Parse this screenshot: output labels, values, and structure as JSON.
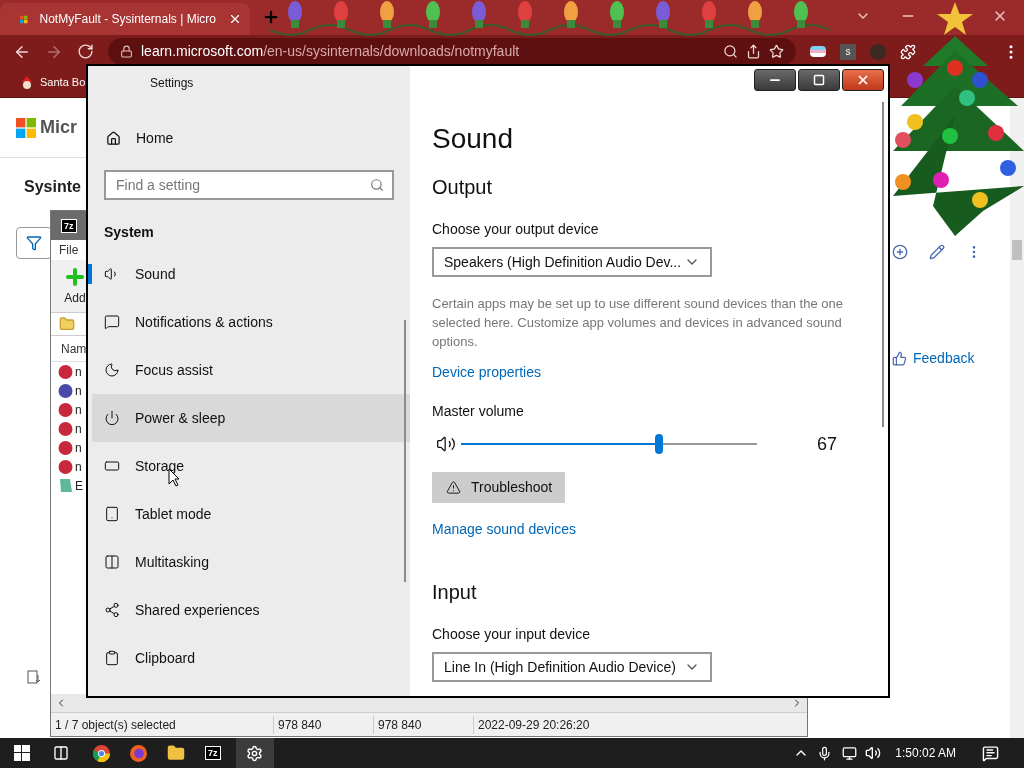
{
  "browser": {
    "tab_title": "NotMyFault - Sysinternals | Micro",
    "url_host": "learn.microsoft.com",
    "url_path": "/en-us/sysinternals/downloads/notmyfault",
    "bookmark": "Santa Bo",
    "extension_badge": "s"
  },
  "web_page": {
    "logo_text": "Micr",
    "heading": "Sysinte",
    "feedback": "Feedback"
  },
  "archiver": {
    "badge": "7z",
    "menu": "File",
    "toolbar_button": "Add",
    "column": "Nam",
    "rows": [
      {
        "name": "n",
        "kind": "archive",
        "color": "#c8283c"
      },
      {
        "name": "n",
        "kind": "archive",
        "color": "#4a4aa8"
      },
      {
        "name": "n",
        "kind": "archive",
        "color": "#c8283c"
      },
      {
        "name": "n",
        "kind": "archive",
        "color": "#c8283c"
      },
      {
        "name": "n",
        "kind": "archive",
        "color": "#c8283c"
      },
      {
        "name": "n",
        "kind": "archive",
        "color": "#c8283c"
      },
      {
        "name": "E",
        "kind": "document",
        "color": "#5fb89a"
      }
    ],
    "status": [
      "1 / 7 object(s) selected",
      "978 840",
      "978 840",
      "2022-09-29 20:26:20"
    ]
  },
  "settings": {
    "title": "Settings",
    "home": "Home",
    "search_placeholder": "Find a setting",
    "section": "System",
    "nav": [
      {
        "label": "Sound",
        "kind": "sound",
        "selected": true,
        "hovered": false
      },
      {
        "label": "Notifications & actions",
        "kind": "notifications",
        "selected": false,
        "hovered": false
      },
      {
        "label": "Focus assist",
        "kind": "focus",
        "selected": false,
        "hovered": false
      },
      {
        "label": "Power & sleep",
        "kind": "power",
        "selected": false,
        "hovered": true
      },
      {
        "label": "Storage",
        "kind": "storage",
        "selected": false,
        "hovered": false
      },
      {
        "label": "Tablet mode",
        "kind": "tablet",
        "selected": false,
        "hovered": false
      },
      {
        "label": "Multitasking",
        "kind": "multitasking",
        "selected": false,
        "hovered": false
      },
      {
        "label": "Shared experiences",
        "kind": "shared",
        "selected": false,
        "hovered": false
      },
      {
        "label": "Clipboard",
        "kind": "clipboard",
        "selected": false,
        "hovered": false
      }
    ],
    "page_title": "Sound",
    "output": {
      "heading": "Output",
      "device_label": "Choose your output device",
      "device": "Speakers (High Definition Audio Dev...",
      "note": "Certain apps may be set up to use different sound devices than the one selected here. Customize app volumes and devices in advanced sound options.",
      "link": "Device properties",
      "volume_label": "Master volume",
      "level": 0.67,
      "reading": "67",
      "troubleshoot": "Troubleshoot",
      "manage": "Manage sound devices"
    },
    "input": {
      "heading": "Input",
      "device_label": "Choose your input device",
      "device": "Line In (High Definition Audio Device)"
    }
  },
  "taskbar": {
    "archiver_badge": "7z",
    "time": "1:50:02 AM"
  }
}
